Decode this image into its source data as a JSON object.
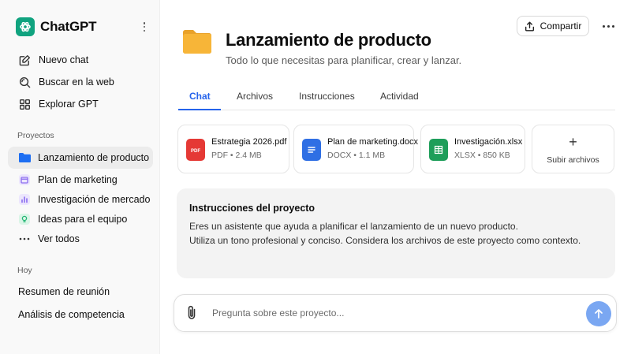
{
  "sidebar": {
    "brand": "ChatGPT",
    "nav": [
      {
        "label": "Nuevo chat",
        "icon": "edit-icon"
      },
      {
        "label": "Buscar en la web",
        "icon": "web-search-icon"
      },
      {
        "label": "Explorar GPT",
        "icon": "grid-icon"
      }
    ],
    "projects_label": "Proyectos",
    "projects": [
      {
        "label": "Lanzamiento de producto",
        "icon": "folder-icon",
        "color": "#1d6ef2"
      },
      {
        "label": "Plan de marketing",
        "icon": "calendar-icon",
        "color": "#8b6cf0"
      },
      {
        "label": "Investigación de mercado",
        "icon": "chart-icon",
        "color": "#8b6cf0"
      },
      {
        "label": "Ideas para el equipo",
        "icon": "bulb-icon",
        "color": "#22b573"
      },
      {
        "label": "Ver todos",
        "icon": "more-icon"
      }
    ],
    "today_label": "Hoy",
    "chats": [
      "Resumen de reunión",
      "Análisis de competencia"
    ]
  },
  "header": {
    "share_label": "Compartir",
    "title": "Lanzamiento de producto",
    "subtitle": "Todo lo que necesitas para planificar, crear y lanzar."
  },
  "tabs": [
    {
      "label": "Chat",
      "active": true
    },
    {
      "label": "Archivos",
      "active": false
    },
    {
      "label": "Instrucciones",
      "active": false
    },
    {
      "label": "Actividad",
      "active": false
    }
  ],
  "files": [
    {
      "name": "Estrategia 2026.pdf",
      "meta": "PDF • 2.4 MB",
      "icon": "pdf-icon",
      "color": "#e53935"
    },
    {
      "name": "Plan de marketing.docx",
      "meta": "DOCX • 1.1 MB",
      "icon": "doc-icon",
      "color": "#2f6fe4"
    },
    {
      "name": "Investigación.xlsx",
      "meta": "XLSX • 850 KB",
      "icon": "sheet-icon",
      "color": "#1e9e5a"
    }
  ],
  "upload_label": "Subir archivos",
  "instructions": {
    "title": "Instrucciones del proyecto",
    "lines": [
      "Eres un asistente que ayuda a planificar el lanzamiento de un nuevo producto.",
      "Utiliza un tono profesional y conciso. Considera los archivos de este proyecto como contexto."
    ]
  },
  "composer": {
    "placeholder": "Pregunta sobre este proyecto..."
  },
  "colors": {
    "accent": "#2563eb",
    "brand": "#10a37f",
    "folder": "#f7b538",
    "send": "#7aa7f2"
  }
}
